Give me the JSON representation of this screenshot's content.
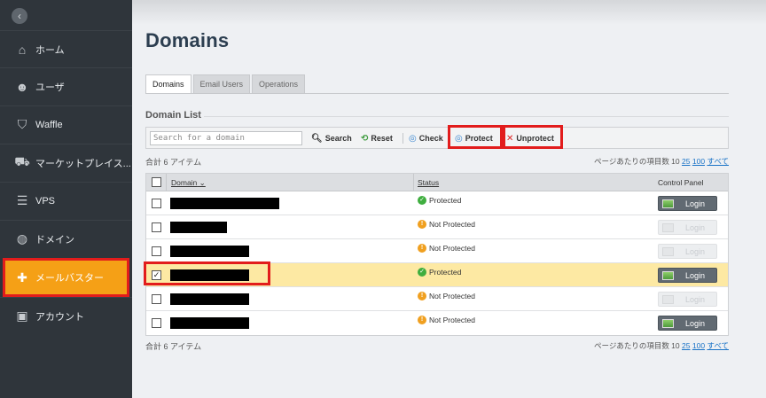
{
  "sidebar": {
    "collapse_icon": "chevron-left-icon",
    "items": [
      {
        "label": "ホーム",
        "icon": "home-icon"
      },
      {
        "label": "ユーザ",
        "icon": "users-icon"
      },
      {
        "label": "Waffle",
        "icon": "shield-icon"
      },
      {
        "label": "マーケットプレイス...",
        "icon": "cart-icon"
      },
      {
        "label": "VPS",
        "icon": "server-icon"
      },
      {
        "label": "ドメイン",
        "icon": "globe-icon"
      },
      {
        "label": "メールバスター",
        "icon": "puzzle-icon"
      },
      {
        "label": "アカウント",
        "icon": "briefcase-icon"
      }
    ],
    "active_index": 6
  },
  "page": {
    "title": "Domains"
  },
  "tabs": [
    {
      "label": "Domains",
      "active": true
    },
    {
      "label": "Email Users",
      "active": false
    },
    {
      "label": "Operations",
      "active": false
    }
  ],
  "section": {
    "title": "Domain List"
  },
  "toolbar": {
    "search_placeholder": "Search for a domain",
    "search_label": "Search",
    "reset_label": "Reset",
    "check_label": "Check",
    "protect_label": "Protect",
    "unprotect_label": "Unprotect"
  },
  "summary": {
    "count_text": "合計 6 アイテム",
    "per_page_label": "ページあたりの項目数 10",
    "opt_25": "25",
    "opt_100": "100",
    "opt_all": "すべて"
  },
  "table": {
    "headers": {
      "domain": "Domain",
      "status": "Status",
      "control": "Control Panel"
    },
    "sort_icon": "chevron-down-icon",
    "login_label": "Login",
    "rows": [
      {
        "status": "Protected",
        "login_enabled": true,
        "checked": false
      },
      {
        "status": "Not Protected",
        "login_enabled": false,
        "checked": false
      },
      {
        "status": "Not Protected",
        "login_enabled": false,
        "checked": false
      },
      {
        "status": "Protected",
        "login_enabled": true,
        "checked": true
      },
      {
        "status": "Not Protected",
        "login_enabled": false,
        "checked": false
      },
      {
        "status": "Not Protected",
        "login_enabled": true,
        "checked": false
      }
    ]
  },
  "colors": {
    "accent": "#f5a016",
    "highlight": "#e21c1c",
    "link": "#1a73c7"
  }
}
